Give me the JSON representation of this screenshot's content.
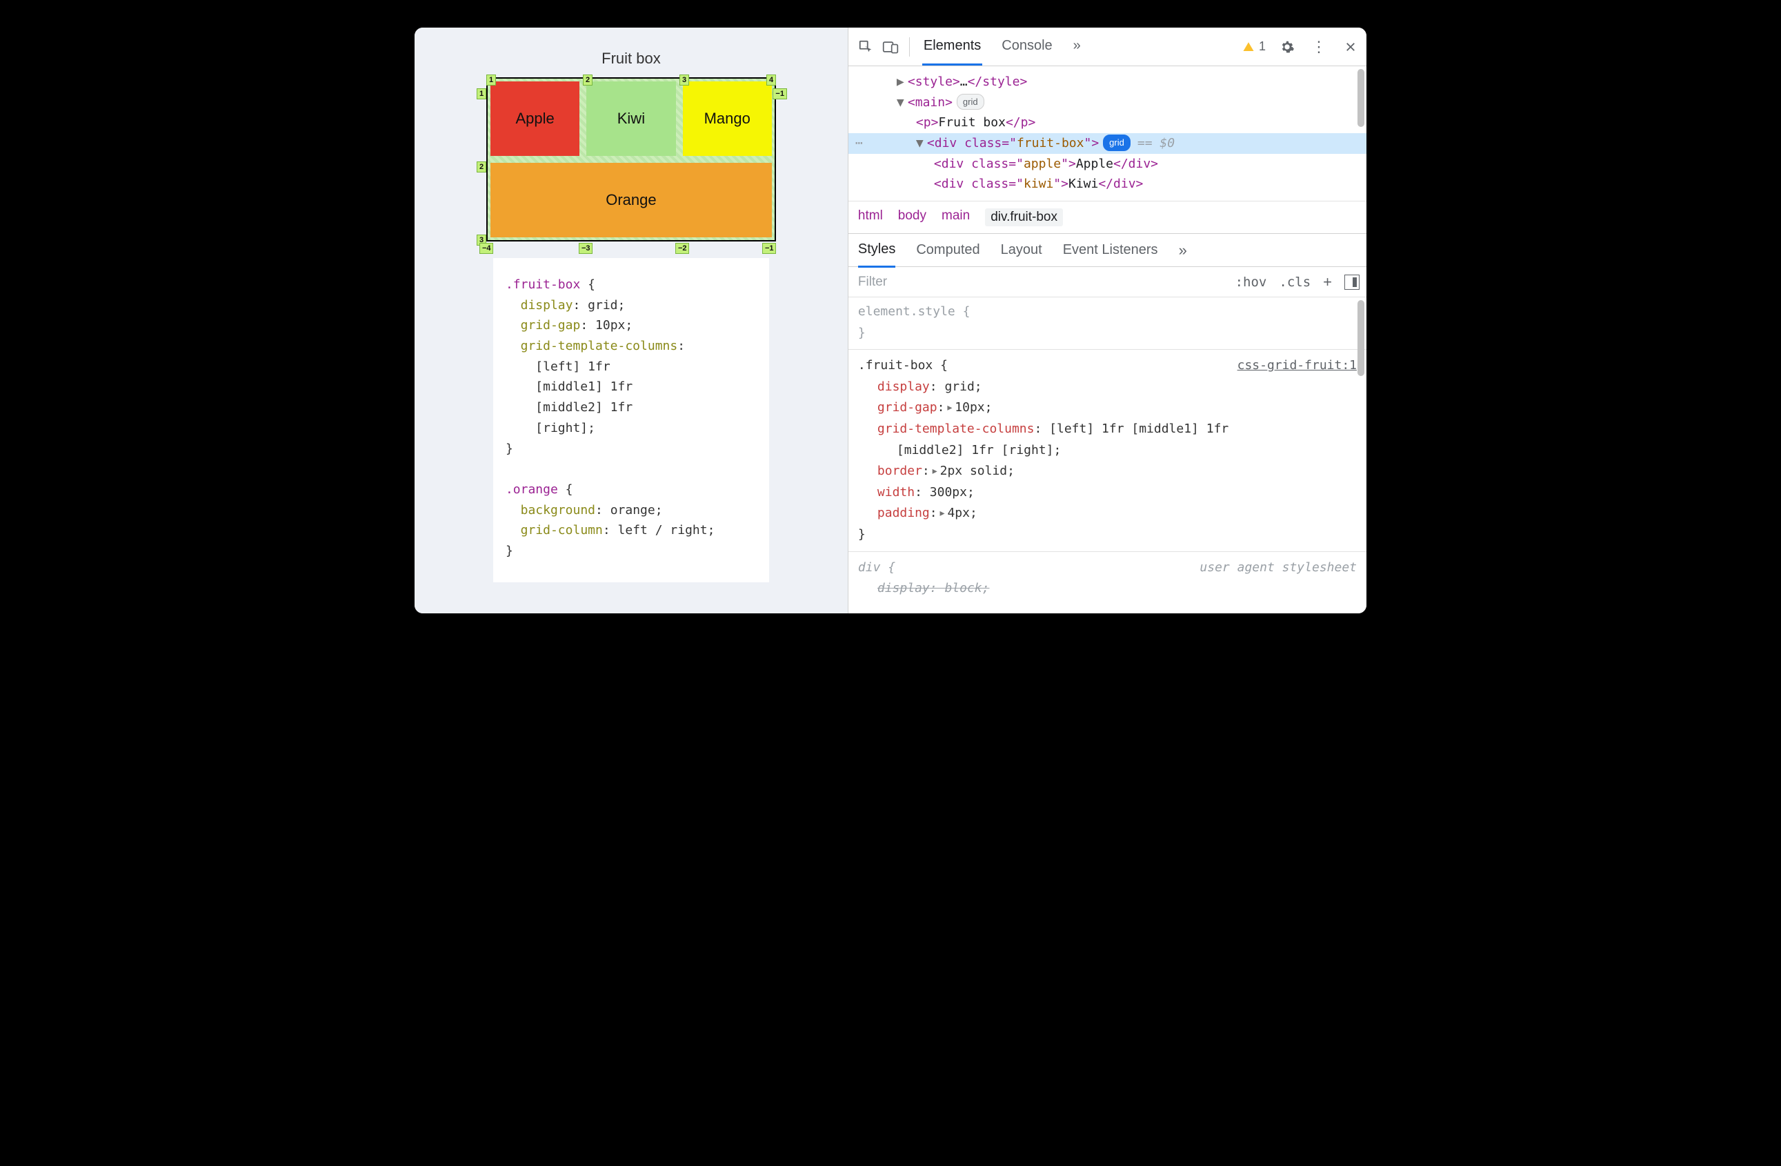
{
  "page": {
    "title": "Fruit box",
    "cells": {
      "apple": "Apple",
      "kiwi": "Kiwi",
      "mango": "Mango",
      "orange": "Orange"
    },
    "overlay": {
      "top": [
        "1",
        "2",
        "3",
        "4"
      ],
      "bottom": [
        "−4",
        "−3",
        "−2",
        "−1"
      ],
      "left": [
        "1",
        "2",
        "3"
      ],
      "right": [
        "−1"
      ]
    },
    "code": ".fruit-box {\n  display: grid;\n  grid-gap: 10px;\n  grid-template-columns:\n    [left] 1fr\n    [middle1] 1fr\n    [middle2] 1fr\n    [right];\n}\n\n.orange {\n  background: orange;\n  grid-column: left / right;\n}"
  },
  "devtools": {
    "tabs": {
      "elements": "Elements",
      "console": "Console",
      "more": "»"
    },
    "warn_count": "1",
    "dom": {
      "row0": {
        "open": "<style>",
        "mid": "…",
        "close": "</style>"
      },
      "row1": {
        "open": "<main>",
        "pill": "grid"
      },
      "row2": {
        "open": "<p>",
        "text": "Fruit box",
        "close": "</p>"
      },
      "row3": {
        "open": "<div class=\"",
        "cls": "fruit-box",
        "close1": "\">",
        "pill": "grid",
        "eq": "== $0"
      },
      "row4": {
        "open": "<div class=\"",
        "cls": "apple",
        "mid": "\">",
        "text": "Apple",
        "close": "</div>"
      },
      "row5": {
        "open": "<div class=\"",
        "cls": "kiwi",
        "mid": "\">",
        "text": "Kiwi",
        "close": "</div>"
      }
    },
    "crumbs": {
      "c0": "html",
      "c1": "body",
      "c2": "main",
      "c3": "div.fruit-box"
    },
    "styles_tabs": {
      "styles": "Styles",
      "computed": "Computed",
      "layout": "Layout",
      "events": "Event Listeners",
      "more": "»"
    },
    "filter": {
      "placeholder": "Filter",
      "hov": ":hov",
      "cls": ".cls"
    },
    "rules": {
      "element_style": "element.style {",
      "element_style_close": "}",
      "fruit": {
        "selector": ".fruit-box {",
        "source": "css-grid-fruit:1",
        "d1p": "display",
        "d1v": "grid",
        "d2p": "grid-gap",
        "d2v": "10px",
        "d3p": "grid-template-columns",
        "d3v": "[left] 1fr [middle1] 1fr",
        "d3v2": "[middle2] 1fr [right]",
        "d4p": "border",
        "d4v": "2px solid",
        "d5p": "width",
        "d5v": "300px",
        "d6p": "padding",
        "d6v": "4px",
        "close": "}"
      },
      "ua": {
        "selector": "div {",
        "source": "user agent stylesheet",
        "d1p": "display",
        "d1v": "block"
      }
    }
  }
}
